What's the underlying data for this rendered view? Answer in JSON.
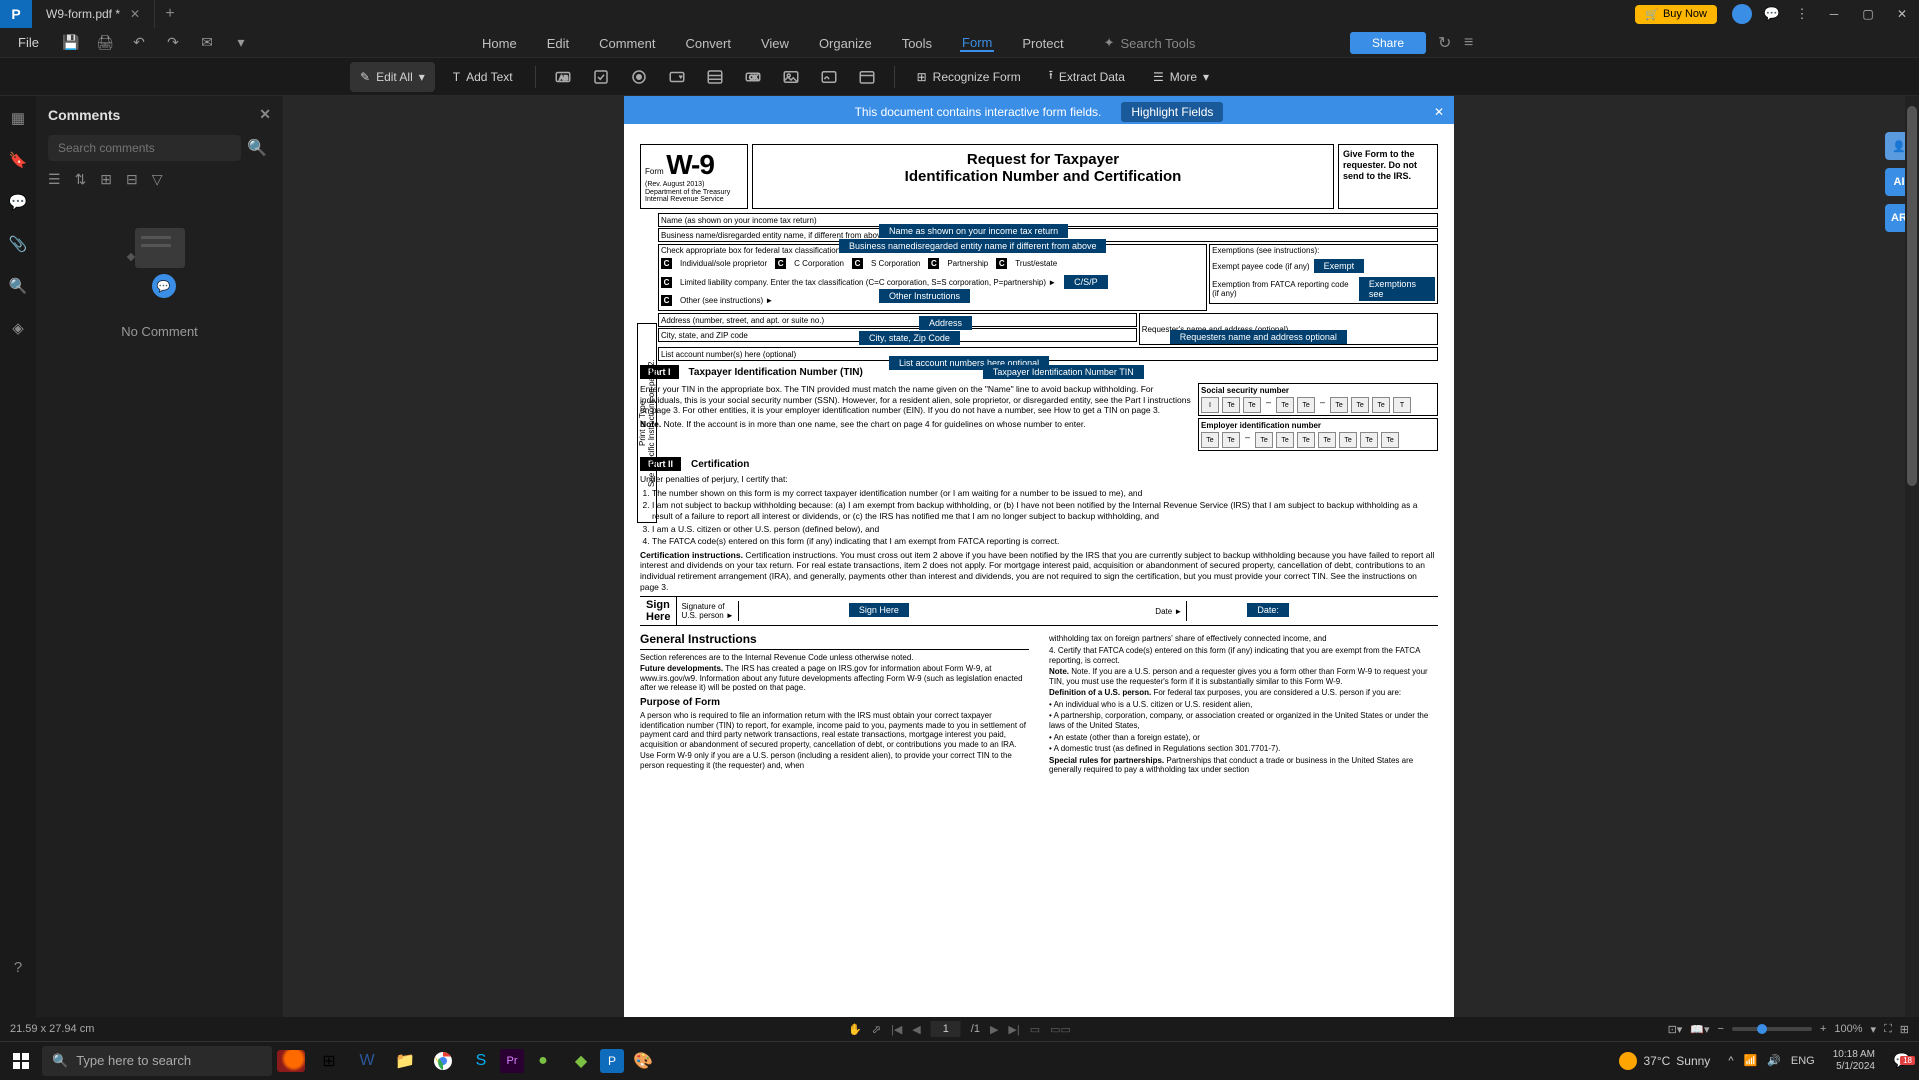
{
  "app": {
    "tab_title": "W9-form.pdf *"
  },
  "buynow": "Buy Now",
  "qat": {
    "file": "File"
  },
  "menu": {
    "items": [
      "Home",
      "Edit",
      "Comment",
      "Convert",
      "View",
      "Organize",
      "Tools",
      "Form",
      "Protect"
    ],
    "active": 7,
    "search_placeholder": "Search Tools",
    "share": "Share"
  },
  "ribbon": {
    "edit_all": "Edit All",
    "add_text": "Add Text",
    "recognize": "Recognize Form",
    "extract": "Extract Data",
    "more": "More"
  },
  "comments": {
    "title": "Comments",
    "search_placeholder": "Search comments",
    "empty": "No Comment"
  },
  "banner": {
    "msg": "This document contains interactive form fields.",
    "btn": "Highlight Fields"
  },
  "form": {
    "form_lbl": "Form",
    "w9": "W-9",
    "rev": "(Rev. August 2013)\nDepartment of the Treasury\nInternal Revenue Service",
    "title1": "Request for Taxpayer",
    "title2": "Identification Number and Certification",
    "give": "Give Form to the requester. Do not send to the IRS.",
    "side": "Print or Type\nSee Specific Instructions on page 2.",
    "name_lbl": "Name (as shown on your income tax return)",
    "name_tag": "Name as shown on your income tax return",
    "bus_lbl": "Business name/disregarded entity name, if different from above",
    "bus_tag": "Business namedisregarded entity name if different from above",
    "check_lbl": "Check appropriate box for federal tax classification:",
    "ck": [
      "Individual/sole proprietor",
      "C Corporation",
      "S Corporation",
      "Partnership",
      "Trust/estate"
    ],
    "llc_lbl": "Limited liability company. Enter the tax classification (C=C corporation, S=S corporation, P=partnership) ►",
    "llc_tag": "C/S/P",
    "other_lbl": "Other (see instructions) ►",
    "other_tag": "Other Instructions",
    "exempt_head": "Exemptions (see instructions):",
    "exempt_payee": "Exempt payee code (if any)",
    "exempt_tag": "Exempt",
    "fatca_lbl": "Exemption from FATCA reporting code (if any)",
    "fatca_tag": "Exemptions see",
    "addr_lbl": "Address (number, street, and apt. or suite no.)",
    "addr_tag": "Address",
    "req_lbl": "Requester's name and address (optional)",
    "req_tag": "Requesters name and address optional",
    "city_lbl": "City, state, and ZIP code",
    "city_tag": "City, state, Zip Code",
    "acct_lbl": "List account number(s) here (optional)",
    "acct_tag": "List account numbers here optional",
    "part1": "Part I",
    "part1_title": "Taxpayer Identification Number (TIN)",
    "tin_tag": "Taxpayer Identification Number TIN",
    "ssn": "Social security number",
    "ein": "Employer identification number",
    "cell_te": "Te",
    "cell_i": "I",
    "tin_body": "Enter your TIN in the appropriate box. The TIN provided must match the name given on the \"Name\" line to avoid backup withholding. For individuals, this is your social security number (SSN). However, for a resident alien, sole proprietor, or disregarded entity, see the Part I instructions on page 3. For other entities, it is your employer identification number (EIN). If you do not have a number, see How to get a TIN on page 3.",
    "tin_note": "Note. If the account is in more than one name, see the chart on page 4 for guidelines on whose number to enter.",
    "part2": "Part II",
    "part2_title": "Certification",
    "cert_intro": "Under penalties of perjury, I certify that:",
    "cert": [
      "The number shown on this form is my correct taxpayer identification number (or I am waiting for a number to be issued to me), and",
      "I am not subject to backup withholding because: (a) I am exempt from backup withholding, or (b) I have not been notified by the Internal Revenue Service (IRS) that I am subject to backup withholding as a result of a failure to report all interest or dividends, or (c) the IRS has notified me that I am no longer subject to backup withholding, and",
      "I am a U.S. citizen or other U.S. person (defined below), and",
      "The FATCA code(s) entered on this form (if any) indicating that I am exempt from FATCA reporting is correct."
    ],
    "cert_instr": "Certification instructions. You must cross out item 2 above if you have been notified by the IRS that you are currently subject to backup withholding because you have failed to report all interest and dividends on your tax return. For real estate transactions, item 2 does not apply. For mortgage interest paid, acquisition or abandonment of secured property, cancellation of debt, contributions to an individual retirement arrangement (IRA), and generally, payments other than interest and dividends, you are not required to sign the certification, but you must provide your correct TIN. See the instructions on page 3.",
    "sign_here": "Sign\nHere",
    "sig_of": "Signature of\nU.S. person ►",
    "sign_tag": "Sign Here",
    "date_lbl": "Date ►",
    "date_tag": "Date:",
    "gi_title": "General Instructions",
    "gi_ref": "Section references are to the Internal Revenue Code unless otherwise noted.",
    "gi_future_h": "Future developments.",
    "gi_future": " The IRS has created a page on IRS.gov for information about Form W-9, at www.irs.gov/w9. Information about any future developments affecting Form W-9 (such as legislation enacted after we release it) will be posted on that page.",
    "purpose_h": "Purpose of Form",
    "purpose": "A person who is required to file an information return with the IRS must obtain your correct taxpayer identification number (TIN) to report, for example, income paid to you, payments made to you in settlement of payment card and third party network transactions, real estate transactions, mortgage interest you paid, acquisition or abandonment of secured property, cancellation of debt, or contributions you made to an IRA.",
    "use": "Use Form W-9 only if you are a U.S. person (including a resident alien), to provide your correct TIN to the person requesting it (the requester) and, when",
    "col2_a": "withholding tax on foreign partners' share of effectively connected income, and",
    "col2_b": "4. Certify that FATCA code(s) entered on this form (if any) indicating that you are exempt from the FATCA reporting, is correct.",
    "col2_note": "Note. If you are a U.S. person and a requester gives you a form other than Form W-9 to request your TIN, you must use the requester's form if it is substantially similar to this Form W-9.",
    "col2_def_h": "Definition of a U.S. person.",
    "col2_def": " For federal tax purposes, you are considered a U.S. person if you are:",
    "col2_bullets": [
      "• An individual who is a U.S. citizen or U.S. resident alien,",
      "• A partnership, corporation, company, or association created or organized in the United States or under the laws of the United States,",
      "• An estate (other than a foreign estate), or",
      "• A domestic trust (as defined in Regulations section 301.7701-7)."
    ],
    "col2_special_h": "Special rules for partnerships.",
    "col2_special": " Partnerships that conduct a trade or business in the United States are generally required to pay a withholding tax under section"
  },
  "rightrail": {
    "ai": "AI",
    "ar": "AR"
  },
  "status": {
    "dim": "21.59 x 27.94 cm",
    "page_cur": "1",
    "page_total": "/1",
    "zoom": "100%"
  },
  "taskbar": {
    "search_placeholder": "Type here to search",
    "weather_temp": "37°C",
    "weather_cond": "Sunny",
    "lang": "ENG",
    "time": "10:18 AM",
    "date": "5/1/2024",
    "notif_count": "18"
  }
}
